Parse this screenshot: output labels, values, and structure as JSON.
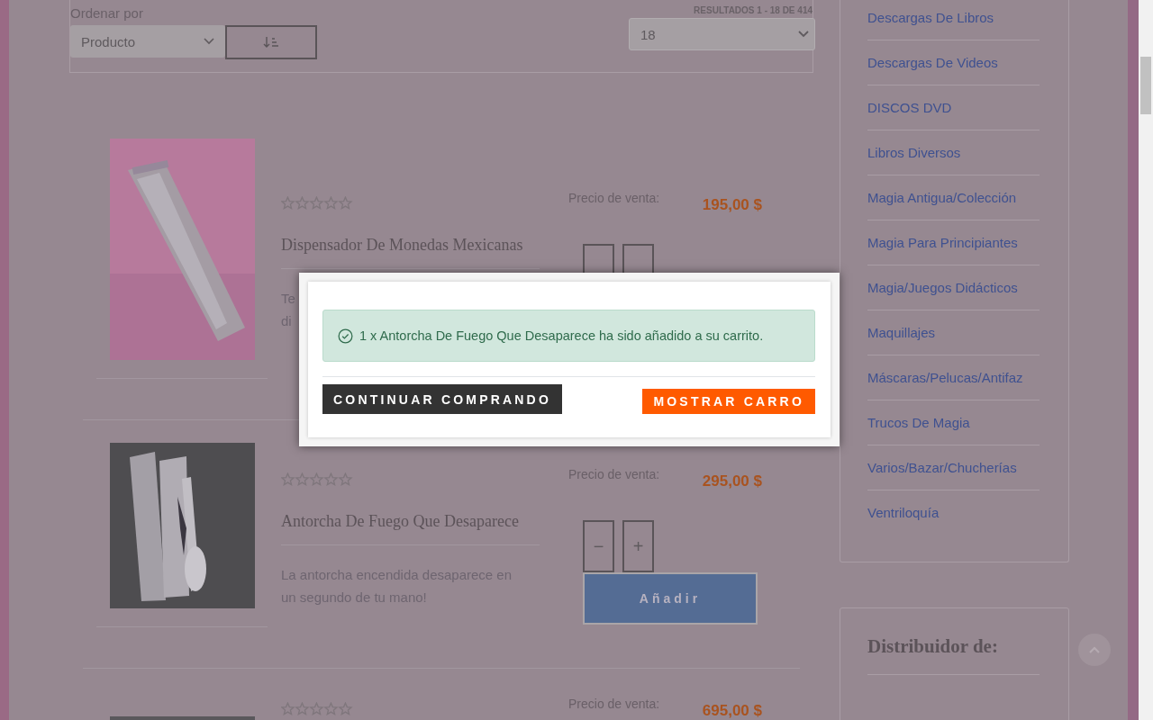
{
  "toolbar": {
    "sort_label": "Ordenar por",
    "sort_select": {
      "value": "Producto"
    },
    "results": "RESULTADOS 1 - 18 DE 414",
    "per_page_select": {
      "value": "18"
    }
  },
  "products": [
    {
      "stars": 0,
      "title": "Dispensador De Monedas Mexicanas",
      "description_lines": [
        "Te",
        "di"
      ],
      "price_label": "Precio de venta:",
      "price": "195,00 $",
      "has_quantity": true
    },
    {
      "stars": 0,
      "title": "Antorcha De Fuego Que Desaparece",
      "description_lines": [
        "La antorcha encendida desaparece en",
        "un segundo de tu mano!"
      ],
      "price_label": "Precio de venta:",
      "price": "295,00 $",
      "has_quantity": true,
      "quantity": {
        "minus": "−",
        "plus": "+"
      },
      "add_button": "Añadir"
    },
    {
      "stars": 0,
      "price_label": "Precio de venta:",
      "price": "695,00 $"
    }
  ],
  "sidebar": {
    "categories": [
      "Descargas De Libros",
      "Descargas De Videos",
      "DISCOS DVD",
      "Libros Diversos",
      "Magia Antigua/Colección",
      "Magia Para Principiantes",
      "Magia/Juegos Didácticos",
      "Maquillajes",
      "Máscaras/Pelucas/Antifaz",
      "Trucos De Magia",
      "Varios/Bazar/Chucherías",
      "Ventriloquía"
    ],
    "distributor_heading": "Distribuidor de:"
  },
  "modal": {
    "message": "1 x Antorcha De Fuego Que Desaparece ha sido añadido a su carrito.",
    "buttons": [
      {
        "label": "CONTINUAR COMPRANDO",
        "kind": "secondary"
      },
      {
        "label": "MOSTRAR CARRO",
        "kind": "primary"
      }
    ]
  }
}
